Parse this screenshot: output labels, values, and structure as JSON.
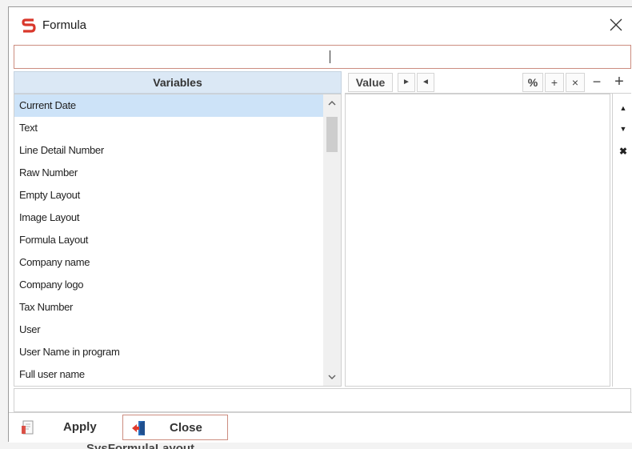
{
  "window": {
    "title": "Formula",
    "close_glyph": "✕",
    "app_icon": "app-logo-icon",
    "colors": {
      "accent": "#dbe8f5",
      "selection": "#cde3f8",
      "brand": "#d9372b",
      "focus_border": "#cc8d80"
    }
  },
  "formula": {
    "value": ""
  },
  "variables": {
    "header": "Variables",
    "items": [
      "Current Date",
      "Text",
      "Line Detail Number",
      "Raw Number",
      "Empty Layout",
      "Image Layout",
      "Formula Layout",
      "Company name",
      "Company logo",
      "Tax Number",
      "User",
      "User Name in program",
      "Full user name"
    ],
    "selected": "Current Date",
    "scroll_up": "▲",
    "scroll_down": "▼"
  },
  "value_toolbar": {
    "value_label": "Value",
    "next": "►",
    "prev": "◄",
    "percent": "%",
    "plus": "+",
    "times": "×",
    "minus": "−",
    "add": "+"
  },
  "side_tools": {
    "move_up": "▲",
    "move_down": "▼",
    "delete": "✖"
  },
  "footer": {
    "apply_label": "Apply",
    "close_label": "Close"
  },
  "background_text": "SysFormulaLayout"
}
